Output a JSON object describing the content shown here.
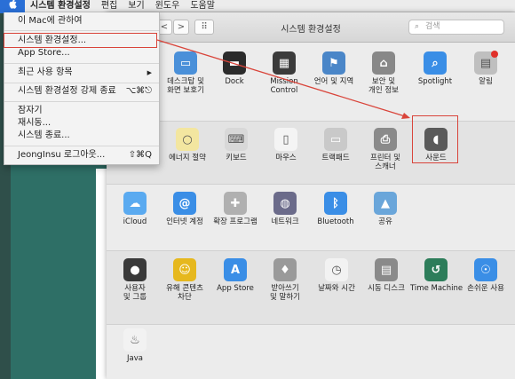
{
  "menubar": {
    "apple": "",
    "app_name": "시스템 환경설정",
    "items": [
      "편집",
      "보기",
      "윈도우",
      "도움말"
    ]
  },
  "apple_menu": {
    "items": [
      {
        "label": "이 Mac에 관하여",
        "shortcut": ""
      },
      {
        "label": "시스템 환경설정...",
        "shortcut": ""
      },
      {
        "label": "App Store...",
        "shortcut": ""
      },
      {
        "label": "최근 사용 항목",
        "shortcut": "▶"
      },
      {
        "label": "시스템 환경설정 강제 종료",
        "shortcut": "⌥⌘⎋"
      },
      {
        "label": "잠자기",
        "shortcut": ""
      },
      {
        "label": "재시동...",
        "shortcut": ""
      },
      {
        "label": "시스템 종료...",
        "shortcut": ""
      },
      {
        "label": "JeongInsu 로그아웃...",
        "shortcut": "⇧⌘Q"
      }
    ]
  },
  "window": {
    "title": "시스템 환경설정",
    "back": "<",
    "forward": ">",
    "grid": "⠿",
    "search_placeholder": "검색"
  },
  "prefs": {
    "row1": [
      {
        "label": "데스크탑 및\n화면 보호기",
        "icon": "desktop-icon",
        "color": "#4a90d9"
      },
      {
        "label": "Dock",
        "icon": "dock-icon",
        "color": "#2b2b2b"
      },
      {
        "label": "Mission\nControl",
        "icon": "mission-control-icon",
        "color": "#3b3b3b"
      },
      {
        "label": "언어 및 지역",
        "icon": "globe-flag-icon",
        "color": "#4a86c8"
      },
      {
        "label": "보안 및\n개인 정보",
        "icon": "house-lock-icon",
        "color": "#888888"
      },
      {
        "label": "Spotlight",
        "icon": "magnifier-icon",
        "color": "#3a8ee6"
      },
      {
        "label": "알림",
        "icon": "notifications-icon",
        "color": "#bfbfbf"
      }
    ],
    "row2": [
      {
        "label": "에너지 절약",
        "icon": "lightbulb-icon",
        "color": "#f3e6a0"
      },
      {
        "label": "키보드",
        "icon": "keyboard-icon",
        "color": "#d8d8d8"
      },
      {
        "label": "마우스",
        "icon": "mouse-icon",
        "color": "#f4f4f4"
      },
      {
        "label": "트랙패드",
        "icon": "trackpad-icon",
        "color": "#c9c9c9"
      },
      {
        "label": "프린터 및\n스캐너",
        "icon": "printer-icon",
        "color": "#8a8a8a"
      },
      {
        "label": "사운드",
        "icon": "speaker-icon",
        "color": "#5a5a5a"
      }
    ],
    "row3": [
      {
        "label": "iCloud",
        "icon": "cloud-icon",
        "color": "#5aaaf0"
      },
      {
        "label": "인터넷 계정",
        "icon": "at-icon",
        "color": "#3a8ee6"
      },
      {
        "label": "확장 프로그램",
        "icon": "puzzle-icon",
        "color": "#b0b0b0"
      },
      {
        "label": "네트워크",
        "icon": "network-globe-icon",
        "color": "#6b6b8a"
      },
      {
        "label": "Bluetooth",
        "icon": "bluetooth-icon",
        "color": "#3a8ee6"
      },
      {
        "label": "공유",
        "icon": "sharing-folder-icon",
        "color": "#6aa6da"
      }
    ],
    "row4": [
      {
        "label": "사용자\n및 그룹",
        "icon": "users-icon",
        "color": "#3a3a3a"
      },
      {
        "label": "유해 콘텐츠\n차단",
        "icon": "parental-controls-icon",
        "color": "#e6b81e"
      },
      {
        "label": "App Store",
        "icon": "app-store-icon",
        "color": "#3a8ee6"
      },
      {
        "label": "받아쓰기\n및 말하기",
        "icon": "microphone-icon",
        "color": "#9a9a9a"
      },
      {
        "label": "날짜와 시간",
        "icon": "clock-calendar-icon",
        "color": "#f2f2f2"
      },
      {
        "label": "시동 디스크",
        "icon": "disk-icon",
        "color": "#8a8a8a"
      },
      {
        "label": "Time Machine",
        "icon": "time-machine-icon",
        "color": "#2d7d5a"
      },
      {
        "label": "손쉬운 사용",
        "icon": "accessibility-icon",
        "color": "#3a8ee6"
      }
    ],
    "row5": [
      {
        "label": "Java",
        "icon": "java-icon",
        "color": "#f2f2f2"
      }
    ]
  },
  "colors": {
    "highlight": "#d9443a",
    "accent": "#2a6fd6"
  }
}
